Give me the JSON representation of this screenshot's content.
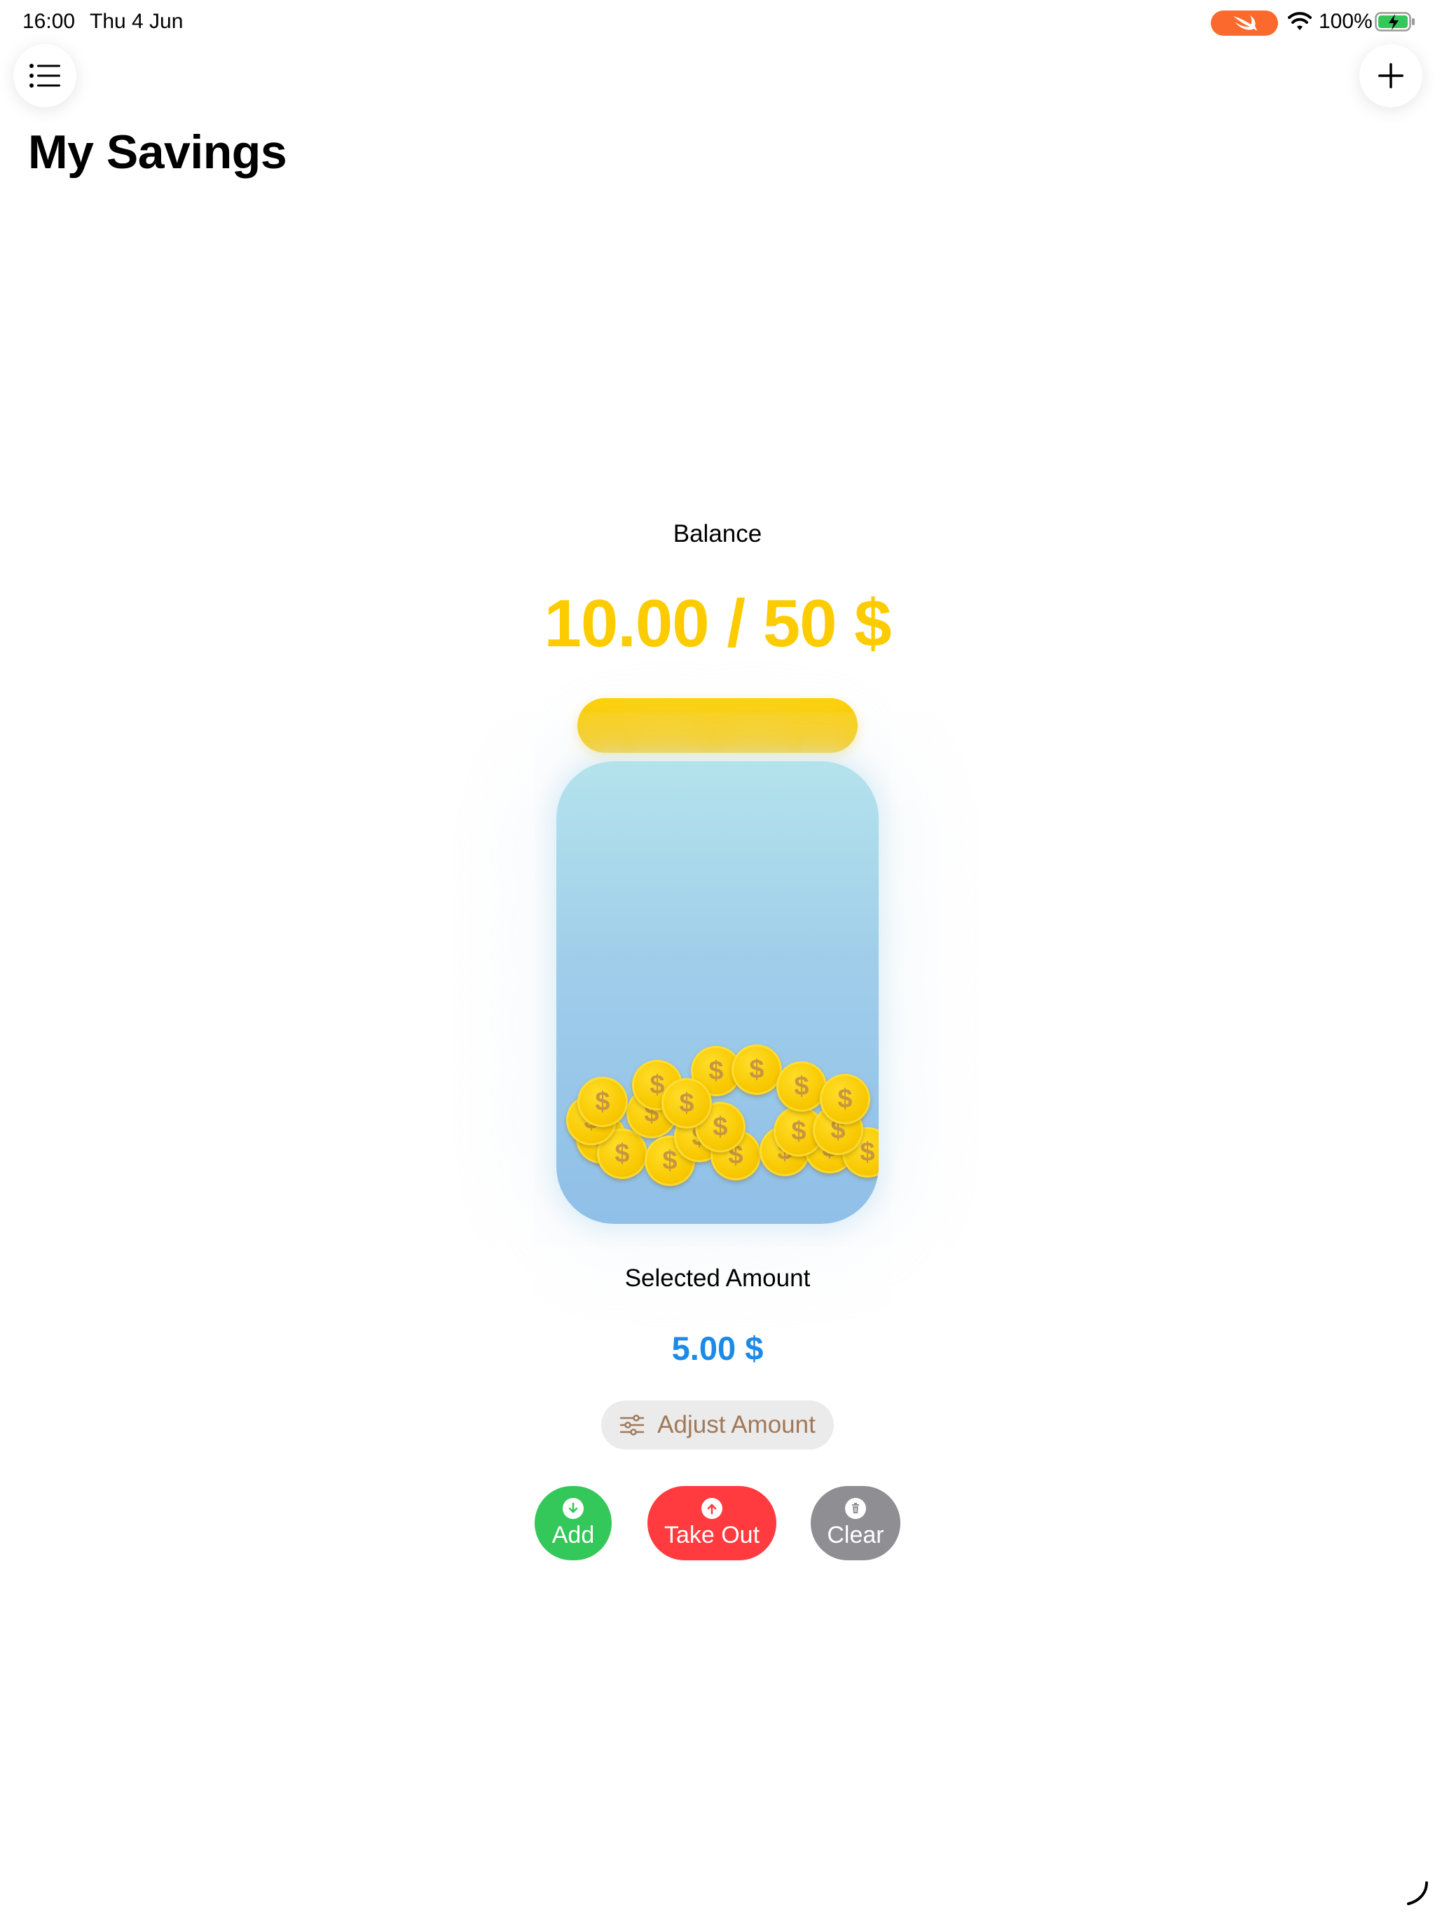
{
  "status_bar": {
    "time": "16:00",
    "date": "Thu 4 Jun",
    "battery_percent": "100%",
    "swift_pill_color": "#fb6a2c",
    "battery_charging_color": "#34c759"
  },
  "header": {
    "title": "My Savings",
    "list_icon": "list-icon",
    "add_icon": "plus-icon"
  },
  "balance": {
    "label": "Balance",
    "value": "10.00 / 50 $",
    "color": "#fccc00",
    "fill_fraction": 0.2
  },
  "jar": {
    "lid_color": "#fccc00",
    "coin_symbol": "$",
    "coin_count": 20
  },
  "selected": {
    "label": "Selected Amount",
    "value": "5.00 $",
    "color": "#1b8ae8"
  },
  "adjust": {
    "label": "Adjust Amount",
    "icon": "sliders-icon"
  },
  "actions": {
    "add": {
      "label": "Add",
      "icon": "arrow-down-circle-icon",
      "color": "#34c759"
    },
    "take_out": {
      "label": "Take Out",
      "icon": "arrow-up-circle-icon",
      "color": "#ff3b3f"
    },
    "clear": {
      "label": "Clear",
      "icon": "trash-icon",
      "color": "#8e8e93"
    }
  }
}
